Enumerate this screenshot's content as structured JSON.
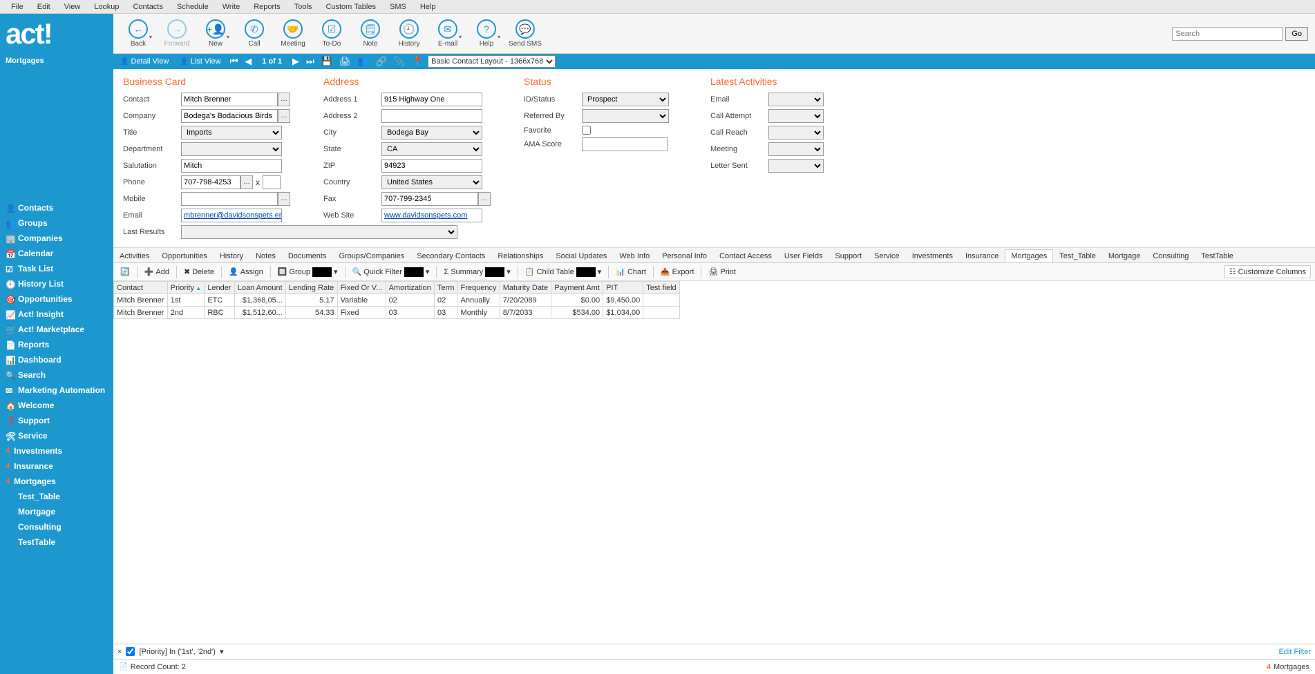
{
  "menubar": [
    "File",
    "Edit",
    "View",
    "Lookup",
    "Contacts",
    "Schedule",
    "Write",
    "Reports",
    "Tools",
    "Custom Tables",
    "SMS",
    "Help"
  ],
  "logo_text": "act!",
  "sidebar_title": "Mortgages",
  "sidebar_nav": [
    {
      "label": "Contacts",
      "icon": "person"
    },
    {
      "label": "Groups",
      "icon": "groups"
    },
    {
      "label": "Companies",
      "icon": "building"
    },
    {
      "label": "Calendar",
      "icon": "calendar"
    },
    {
      "label": "Task List",
      "icon": "check"
    },
    {
      "label": "History List",
      "icon": "history"
    },
    {
      "label": "Opportunities",
      "icon": "target"
    },
    {
      "label": "Act! Insight",
      "icon": "chart"
    },
    {
      "label": "Act! Marketplace",
      "icon": "cart"
    },
    {
      "label": "Reports",
      "icon": "report"
    },
    {
      "label": "Dashboard",
      "icon": "dash"
    },
    {
      "label": "Search",
      "icon": "search"
    },
    {
      "label": "Marketing Automation",
      "icon": "mail"
    },
    {
      "label": "Welcome",
      "icon": "home"
    },
    {
      "label": "Support",
      "icon": "support"
    },
    {
      "label": "Service",
      "icon": "service"
    },
    {
      "label": "Investments",
      "icon": "4"
    },
    {
      "label": "Insurance",
      "icon": "4"
    },
    {
      "label": "Mortgages",
      "icon": "4"
    },
    {
      "label": "Test_Table",
      "icon": ""
    },
    {
      "label": "Mortgage",
      "icon": ""
    },
    {
      "label": "Consulting",
      "icon": ""
    },
    {
      "label": "TestTable",
      "icon": ""
    }
  ],
  "toolbar": {
    "back": "Back",
    "forward": "Forward",
    "new": "New",
    "call": "Call",
    "meeting": "Meeting",
    "todo": "To-Do",
    "note": "Note",
    "history": "History",
    "email": "E-mail",
    "help": "Help",
    "sms": "Send SMS"
  },
  "search": {
    "placeholder": "Search",
    "go": "Go"
  },
  "bluestrip": {
    "detail": "Detail View",
    "list": "List View",
    "page": "1 of 1",
    "layout": "Basic Contact Layout - 1366x768"
  },
  "sections": {
    "biz": "Business Card",
    "addr": "Address",
    "status": "Status",
    "latest": "Latest Activities"
  },
  "labels": {
    "contact": "Contact",
    "company": "Company",
    "title": "Title",
    "department": "Department",
    "salutation": "Salutation",
    "phone": "Phone",
    "phone_x": "x",
    "mobile": "Mobile",
    "email": "Email",
    "lastresults": "Last Results",
    "addr1": "Address 1",
    "addr2": "Address 2",
    "city": "City",
    "state": "State",
    "zip": "ZIP",
    "country": "Country",
    "fax": "Fax",
    "website": "Web Site",
    "idstatus": "ID/Status",
    "referred": "Referred By",
    "favorite": "Favorite",
    "ama": "AMA Score",
    "la_email": "Email",
    "la_callattempt": "Call Attempt",
    "la_callreach": "Call Reach",
    "la_meeting": "Meeting",
    "la_lettersent": "Letter Sent"
  },
  "values": {
    "contact": "Mitch Brenner",
    "company": "Bodega's Bodacious Birds",
    "title": "Imports",
    "department": "",
    "salutation": "Mitch",
    "phone": "707-798-4253",
    "phone_ext": "",
    "mobile": "",
    "email": "mbrenner@davidsonspets.ema",
    "addr1": "915 Highway One",
    "addr2": "",
    "city": "Bodega Bay",
    "state": "CA",
    "zip": "94923",
    "country": "United States",
    "fax": "707-799-2345",
    "website": "www.davidsonspets.com",
    "idstatus": "Prospect",
    "referred": "",
    "favorite": false,
    "ama": "",
    "la_email": "",
    "la_callattempt": "",
    "la_callreach": "",
    "la_meeting": "",
    "la_lettersent": ""
  },
  "subtabs": [
    "Activities",
    "Opportunities",
    "History",
    "Notes",
    "Documents",
    "Groups/Companies",
    "Secondary Contacts",
    "Relationships",
    "Social Updates",
    "Web Info",
    "Personal Info",
    "Contact Access",
    "User Fields",
    "Support",
    "Service",
    "Investments",
    "Insurance",
    "Mortgages",
    "Test_Table",
    "Mortgage",
    "Consulting",
    "TestTable"
  ],
  "subtab_active": "Mortgages",
  "subtoolbar": {
    "add": "Add",
    "delete": "Delete",
    "assign": "Assign",
    "group": "Group",
    "quickfilter": "Quick Filter",
    "summary": "Summary",
    "childtable": "Child Table",
    "chart": "Chart",
    "export": "Export",
    "print": "Print",
    "customize": "Customize Columns"
  },
  "grid": {
    "columns": [
      "Contact",
      "Priority",
      "Lender",
      "Loan Amount",
      "Lending Rate",
      "Fixed Or V...",
      "Amortization",
      "Term",
      "Frequency",
      "Maturity Date",
      "Payment Amt",
      "PIT",
      "Test field"
    ],
    "sort_col": "Priority",
    "rows": [
      {
        "Contact": "Mitch Brenner",
        "Priority": "1st",
        "Lender": "ETC",
        "Loan Amount": "$1,368,05...",
        "Lending Rate": "5.17",
        "Fixed Or V...": "Variable",
        "Amortization": "02",
        "Term": "02",
        "Frequency": "Annually",
        "Maturity Date": "7/20/2089",
        "Payment Amt": "$0.00",
        "PIT": "$9,450.00",
        "Test field": ""
      },
      {
        "Contact": "Mitch Brenner",
        "Priority": "2nd",
        "Lender": "RBC",
        "Loan Amount": "$1,512,60...",
        "Lending Rate": "54.33",
        "Fixed Or V...": "Fixed",
        "Amortization": "03",
        "Term": "03",
        "Frequency": "Monthly",
        "Maturity Date": "8/7/2033",
        "Payment Amt": "$534.00",
        "PIT": "$1,034.00",
        "Test field": ""
      }
    ]
  },
  "filter": {
    "clear": "×",
    "text": "[Priority] In ('1st', '2nd')",
    "edit": "Edit Filter"
  },
  "statusbar": {
    "count": "Record Count: 2",
    "right": "Mortgages"
  }
}
